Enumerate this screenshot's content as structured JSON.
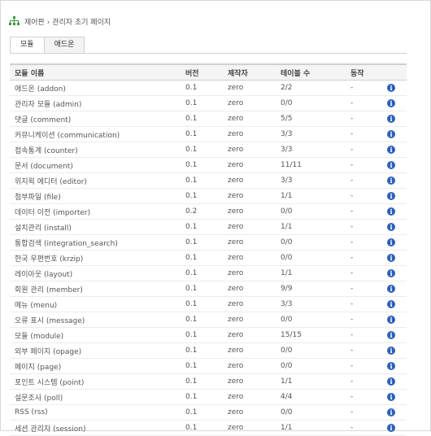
{
  "header": {
    "title": "제어판 › 관리자 초기 페이지"
  },
  "tabs": [
    {
      "label": "모듈"
    },
    {
      "label": "애드온"
    }
  ],
  "columns": [
    "모듈 이름",
    "버전",
    "제작자",
    "테이블 수",
    "동작"
  ],
  "rows": [
    {
      "name": "애드온 (addon)",
      "version": "0.1",
      "author": "zero",
      "tables": "2/2",
      "action": "-"
    },
    {
      "name": "관리자 모듈 (admin)",
      "version": "0.1",
      "author": "zero",
      "tables": "0/0",
      "action": "-"
    },
    {
      "name": "댓글 (comment)",
      "version": "0.1",
      "author": "zero",
      "tables": "5/5",
      "action": "-"
    },
    {
      "name": "커뮤니케이션 (communication)",
      "version": "0.1",
      "author": "zero",
      "tables": "3/3",
      "action": "-"
    },
    {
      "name": "접속통계 (counter)",
      "version": "0.1",
      "author": "zero",
      "tables": "3/3",
      "action": "-"
    },
    {
      "name": "문서 (document)",
      "version": "0.1",
      "author": "zero",
      "tables": "11/11",
      "action": "-"
    },
    {
      "name": "위지윅 에디터 (editor)",
      "version": "0.1",
      "author": "zero",
      "tables": "3/3",
      "action": "-"
    },
    {
      "name": "첨부파일 (file)",
      "version": "0.1",
      "author": "zero",
      "tables": "1/1",
      "action": "-"
    },
    {
      "name": "데이터 이전 (importer)",
      "version": "0.2",
      "author": "zero",
      "tables": "0/0",
      "action": "-"
    },
    {
      "name": "설치관리 (install)",
      "version": "0.1",
      "author": "zero",
      "tables": "1/1",
      "action": "-"
    },
    {
      "name": "통합검색 (integration_search)",
      "version": "0.1",
      "author": "zero",
      "tables": "0/0",
      "action": "-"
    },
    {
      "name": "한국 우편번호 (krzip)",
      "version": "0.1",
      "author": "zero",
      "tables": "0/0",
      "action": "-"
    },
    {
      "name": "레이아웃 (layout)",
      "version": "0.1",
      "author": "zero",
      "tables": "1/1",
      "action": "-"
    },
    {
      "name": "회원 관리 (member)",
      "version": "0.1",
      "author": "zero",
      "tables": "9/9",
      "action": "-"
    },
    {
      "name": "메뉴 (menu)",
      "version": "0.1",
      "author": "zero",
      "tables": "3/3",
      "action": "-"
    },
    {
      "name": "오류 표시 (message)",
      "version": "0.1",
      "author": "zero",
      "tables": "0/0",
      "action": "-"
    },
    {
      "name": "모듈 (module)",
      "version": "0.1",
      "author": "zero",
      "tables": "15/15",
      "action": "-"
    },
    {
      "name": "외부 페이지 (opage)",
      "version": "0.1",
      "author": "zero",
      "tables": "0/0",
      "action": "-"
    },
    {
      "name": "페이지 (page)",
      "version": "0.1",
      "author": "zero",
      "tables": "0/0",
      "action": "-"
    },
    {
      "name": "포인트 시스템 (point)",
      "version": "0.1",
      "author": "zero",
      "tables": "1/1",
      "action": "-"
    },
    {
      "name": "설문조사 (poll)",
      "version": "0.1",
      "author": "zero",
      "tables": "4/4",
      "action": "-"
    },
    {
      "name": "RSS (rss)",
      "version": "0.1",
      "author": "zero",
      "tables": "0/0",
      "action": "-"
    },
    {
      "name": "세션 관리자 (session)",
      "version": "0.1",
      "author": "zero",
      "tables": "1/1",
      "action": "-"
    }
  ],
  "icons": {
    "info": "info-icon",
    "sitemap": "sitemap-icon"
  },
  "colors": {
    "info": "#2b5fb8",
    "sitemap": "#3a9a3a"
  }
}
